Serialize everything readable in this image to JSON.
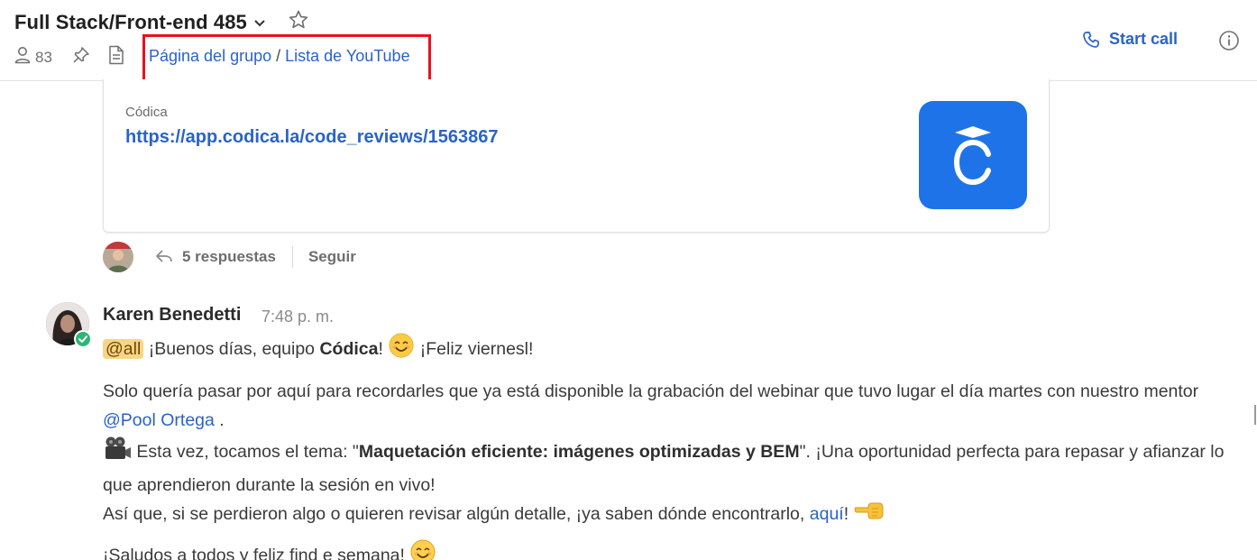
{
  "header": {
    "title": "Full Stack/Front-end 485",
    "member_count": "83",
    "links": {
      "group_page": "Página del grupo",
      "separator": " / ",
      "youtube_list": "Lista de YouTube"
    },
    "start_call_label": "Start call",
    "highlight_color": "#e8121e",
    "accent_color": "#2a63c6",
    "icons": [
      "user-icon",
      "pin-icon",
      "document-icon",
      "chevron-down-icon",
      "star-icon",
      "phone-icon",
      "info-icon"
    ]
  },
  "link_preview": {
    "site_name": "Códica",
    "url": "https://app.codica.la/code_reviews/1563867",
    "logo_color": "#1f73e8"
  },
  "thread": {
    "replies_label": "5 respuestas",
    "follow_label": "Seguir"
  },
  "message": {
    "author": "Karen Benedetti",
    "time": "7:48 p. m.",
    "line1": {
      "mention_all": "@all",
      "text_a": " ¡Buenos días, equipo ",
      "bold": "Códica",
      "text_b": "! ",
      "text_c": " ¡Feliz viernesl!"
    },
    "para2": {
      "text_a": "Solo quería pasar por aquí para recordarles que ya está disponible la grabación del webinar que tuvo lugar el día martes con nuestro mentor ",
      "mention": "@Pool Ortega",
      "text_b": " .",
      "text_c": " Esta vez, tocamos el tema: \"",
      "bold": "Maquetación eficiente: imágenes optimizadas y BEM",
      "text_d": "\". ¡Una oportunidad perfecta para repasar y afianzar lo que aprendieron durante la sesión en vivo!",
      "text_e": "Así que, si se perdieron algo o quieren revisar algún detalle, ¡ya saben dónde encontrarlo, ",
      "link": "aquí",
      "text_f": "! "
    },
    "line_last": "¡Saludos a todos y feliz find e semana! ",
    "emojis": [
      "smiling-face-emoji",
      "movie-camera-emoji",
      "pointing-left-emoji",
      "smiling-face-emoji"
    ],
    "online_color": "#2bb673",
    "mention_all_bg": "#f8d585"
  }
}
